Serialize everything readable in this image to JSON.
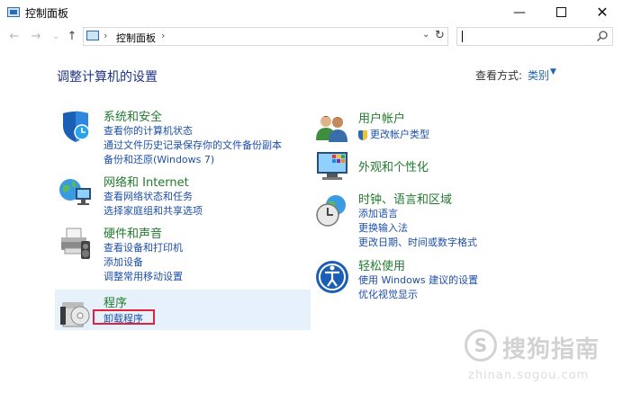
{
  "window": {
    "title": "控制面板",
    "minimize_glyph": "—",
    "close_glyph": "✕"
  },
  "nav": {
    "back_glyph": "←",
    "forward_glyph": "→",
    "recent_glyph": "⌄",
    "up_glyph": "↑",
    "address_separator": "›",
    "address_text": "控制面板",
    "address_dropdown_glyph": "⌄",
    "refresh_glyph": "↻",
    "search_placeholder": ""
  },
  "page": {
    "heading": "调整计算机的设置",
    "view_by_label": "查看方式:",
    "view_by_value": "类别",
    "view_by_caret": "▼"
  },
  "categories": [
    {
      "id": "system-security",
      "icon": "shield-icon",
      "title": "系统和安全",
      "links": [
        "查看你的计算机状态",
        "通过文件历史记录保存你的文件备份副本",
        "备份和还原(Windows 7)"
      ]
    },
    {
      "id": "network-internet",
      "icon": "globe-network-icon",
      "title": "网络和 Internet",
      "links": [
        "查看网络状态和任务",
        "选择家庭组和共享选项"
      ]
    },
    {
      "id": "hardware-sound",
      "icon": "printer-icon",
      "title": "硬件和声音",
      "links": [
        "查看设备和打印机",
        "添加设备",
        "调整常用移动设置"
      ]
    },
    {
      "id": "programs",
      "icon": "programs-box-icon",
      "title": "程序",
      "links": [
        "卸载程序"
      ]
    },
    {
      "id": "user-accounts",
      "icon": "users-icon",
      "title": "用户帐户",
      "links": [
        "更改帐户类型"
      ]
    },
    {
      "id": "appearance",
      "icon": "monitor-palette-icon",
      "title": "外观和个性化",
      "links": []
    },
    {
      "id": "clock-region",
      "icon": "clock-globe-icon",
      "title": "时钟、语言和区域",
      "links": [
        "添加语言",
        "更换输入法",
        "更改日期、时间或数字格式"
      ]
    },
    {
      "id": "ease-of-access",
      "icon": "ease-of-access-icon",
      "title": "轻松使用",
      "links": [
        "使用 Windows 建议的设置",
        "优化视觉显示"
      ]
    }
  ],
  "watermark": {
    "logo_letter": "S",
    "text": "搜狗指南",
    "url": "zhinan.sogou.com"
  }
}
